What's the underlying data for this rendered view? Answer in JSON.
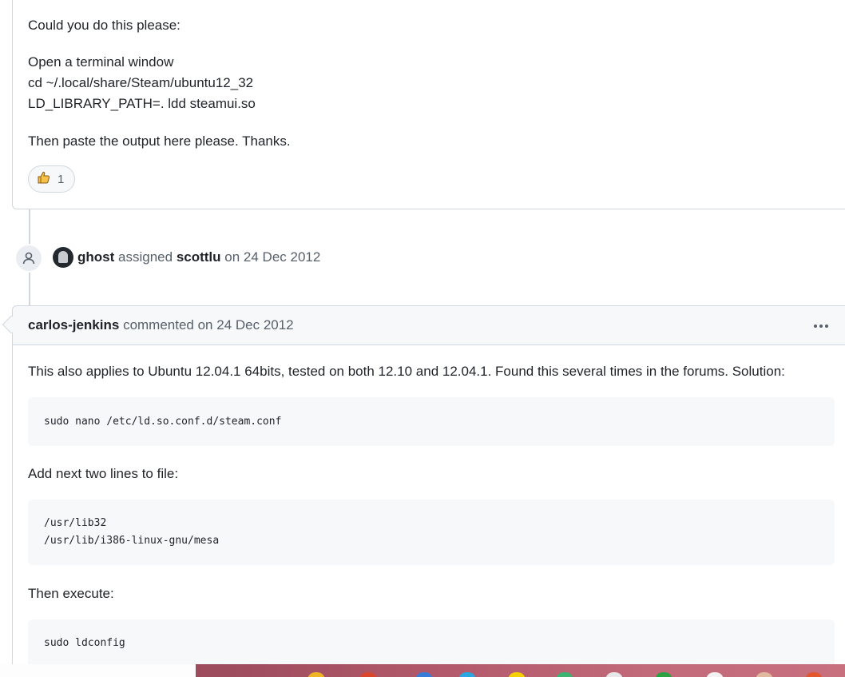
{
  "comment1": {
    "paragraphs": {
      "p1": "Could you do this please:",
      "p2_line1": "Open a terminal window",
      "p2_line2": "cd ~/.local/share/Steam/ubuntu12_32",
      "p2_line3": "LD_LIBRARY_PATH=. ldd steamui.so",
      "p3": "Then paste the output here please. Thanks."
    },
    "reaction": {
      "icon": "thumbs-up-icon",
      "count": "1"
    }
  },
  "event": {
    "icon": "person-icon",
    "actor": "ghost",
    "action": "assigned",
    "assignee": "scottlu",
    "date": "on 24 Dec 2012"
  },
  "comment2": {
    "author": "carlos-jenkins",
    "meta": "commented on 24 Dec 2012",
    "menu_icon": "kebab-horizontal-icon",
    "text1": "This also applies to Ubuntu 12.04.1 64bits, tested on both 12.10 and 12.04.1. Found this several times in the forums. Solution:",
    "code1": "sudo nano /etc/ld.so.conf.d/steam.conf",
    "text2": "Add next two lines to file:",
    "code2_line1": "/usr/lib32",
    "code2_line2": "/usr/lib/i386-linux-gnu/mesa",
    "text3": "Then execute:",
    "code3": "sudo ldconfig"
  },
  "colors": {
    "border": "#d0d7de",
    "header_bg": "#f6f8fa",
    "text": "#1f2328",
    "muted": "#57606a"
  }
}
